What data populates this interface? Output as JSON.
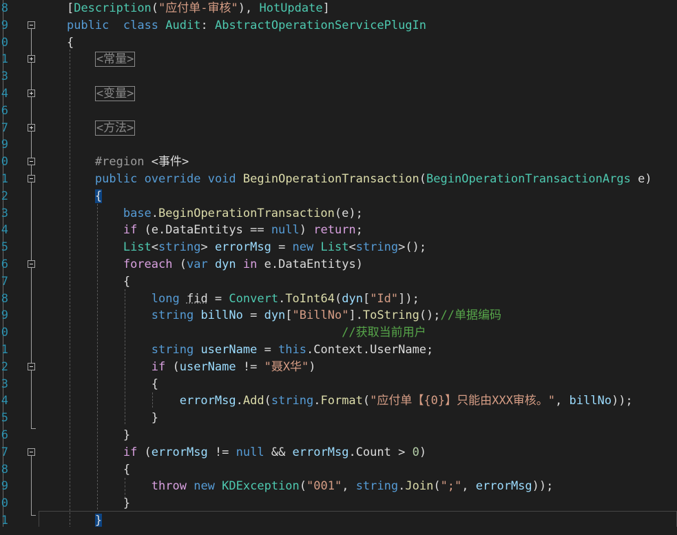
{
  "lines": [
    {
      "ln": "8",
      "indent": "    ",
      "tokens": [
        [
          "pl",
          "["
        ],
        [
          "type",
          "Description"
        ],
        [
          "pl",
          "("
        ],
        [
          "str",
          "\"应付单-审核\""
        ],
        [
          "pl",
          "), "
        ],
        [
          "type",
          "HotUpdate"
        ],
        [
          "pl",
          "]"
        ]
      ]
    },
    {
      "ln": "9",
      "indent": "    ",
      "fold": "minus",
      "tokens": [
        [
          "kw",
          "public"
        ],
        [
          "pl",
          "  "
        ],
        [
          "kw",
          "class"
        ],
        [
          "pl",
          " "
        ],
        [
          "type",
          "Audit"
        ],
        [
          "pl",
          ": "
        ],
        [
          "type",
          "AbstractOperationServicePlugIn"
        ]
      ]
    },
    {
      "ln": "0",
      "indent": "    ",
      "tokens": [
        [
          "pl",
          "{"
        ]
      ]
    },
    {
      "ln": "1",
      "indent": "        ",
      "fold": "plus",
      "tokens": [
        [
          "box",
          "<常量>"
        ]
      ]
    },
    {
      "ln": "3",
      "indent": "",
      "tokens": []
    },
    {
      "ln": "4",
      "indent": "        ",
      "fold": "plus",
      "tokens": [
        [
          "box",
          "<变量>"
        ]
      ]
    },
    {
      "ln": "6",
      "indent": "",
      "tokens": []
    },
    {
      "ln": "7",
      "indent": "        ",
      "fold": "plus",
      "tokens": [
        [
          "box",
          "<方法>"
        ]
      ]
    },
    {
      "ln": "9",
      "indent": "",
      "tokens": []
    },
    {
      "ln": "0",
      "indent": "        ",
      "fold": "minus",
      "tokens": [
        [
          "dir",
          "#region"
        ],
        [
          "pl",
          " "
        ],
        [
          "reg",
          "<事件>"
        ]
      ]
    },
    {
      "ln": "1",
      "indent": "        ",
      "fold": "minus",
      "tokens": [
        [
          "kw",
          "public"
        ],
        [
          "pl",
          " "
        ],
        [
          "kw",
          "override"
        ],
        [
          "pl",
          " "
        ],
        [
          "kw",
          "void"
        ],
        [
          "pl",
          " "
        ],
        [
          "meth",
          "BeginOperationTransaction"
        ],
        [
          "pl",
          "("
        ],
        [
          "type",
          "BeginOperationTransactionArgs"
        ],
        [
          "pl",
          " e)"
        ]
      ]
    },
    {
      "ln": "2",
      "indent": "        ",
      "tokens": [
        [
          "brace",
          "{"
        ]
      ]
    },
    {
      "ln": "3",
      "indent": "            ",
      "tokens": [
        [
          "kw",
          "base"
        ],
        [
          "pl",
          "."
        ],
        [
          "meth",
          "BeginOperationTransaction"
        ],
        [
          "pl",
          "(e);"
        ]
      ]
    },
    {
      "ln": "4",
      "indent": "            ",
      "tokens": [
        [
          "ctl",
          "if"
        ],
        [
          "pl",
          " (e."
        ],
        [
          "prop",
          "DataEntitys"
        ],
        [
          "pl",
          " == "
        ],
        [
          "kw",
          "null"
        ],
        [
          "pl",
          ") "
        ],
        [
          "ctl",
          "return"
        ],
        [
          "pl",
          ";"
        ]
      ]
    },
    {
      "ln": "5",
      "indent": "            ",
      "tokens": [
        [
          "type",
          "List"
        ],
        [
          "pl",
          "<"
        ],
        [
          "kw",
          "string"
        ],
        [
          "pl",
          "> "
        ],
        [
          "var",
          "errorMsg"
        ],
        [
          "pl",
          " = "
        ],
        [
          "kw",
          "new"
        ],
        [
          "pl",
          " "
        ],
        [
          "type",
          "List"
        ],
        [
          "pl",
          "<"
        ],
        [
          "kw",
          "string"
        ],
        [
          "pl",
          ">();"
        ]
      ]
    },
    {
      "ln": "6",
      "indent": "            ",
      "fold": "minus",
      "tokens": [
        [
          "ctl",
          "foreach"
        ],
        [
          "pl",
          " ("
        ],
        [
          "kw",
          "var"
        ],
        [
          "pl",
          " "
        ],
        [
          "var",
          "dyn"
        ],
        [
          "pl",
          " "
        ],
        [
          "ctl",
          "in"
        ],
        [
          "pl",
          " e."
        ],
        [
          "prop",
          "DataEntitys"
        ],
        [
          "pl",
          ")"
        ]
      ]
    },
    {
      "ln": "7",
      "indent": "            ",
      "tokens": [
        [
          "pl",
          "{"
        ]
      ]
    },
    {
      "ln": "8",
      "indent": "                ",
      "tokens": [
        [
          "kw",
          "long"
        ],
        [
          "pl",
          " "
        ],
        [
          "unused",
          "fid"
        ],
        [
          "pl",
          " = "
        ],
        [
          "type",
          "Convert"
        ],
        [
          "pl",
          "."
        ],
        [
          "meth",
          "ToInt64"
        ],
        [
          "pl",
          "("
        ],
        [
          "var",
          "dyn"
        ],
        [
          "pl",
          "["
        ],
        [
          "str",
          "\"Id\""
        ],
        [
          "pl",
          "]);"
        ]
      ]
    },
    {
      "ln": "9",
      "indent": "                ",
      "tokens": [
        [
          "kw",
          "string"
        ],
        [
          "pl",
          " "
        ],
        [
          "var",
          "billNo"
        ],
        [
          "pl",
          " = "
        ],
        [
          "var",
          "dyn"
        ],
        [
          "pl",
          "["
        ],
        [
          "str",
          "\"BillNo\""
        ],
        [
          "pl",
          "]."
        ],
        [
          "meth",
          "ToString"
        ],
        [
          "pl",
          "();"
        ],
        [
          "cmt",
          "//单据编码"
        ]
      ]
    },
    {
      "ln": "0",
      "indent": "                                           ",
      "tokens": [
        [
          "cmt",
          "//获取当前用户"
        ]
      ]
    },
    {
      "ln": "1",
      "indent": "                ",
      "tokens": [
        [
          "kw",
          "string"
        ],
        [
          "pl",
          " "
        ],
        [
          "var",
          "userName"
        ],
        [
          "pl",
          " = "
        ],
        [
          "kw",
          "this"
        ],
        [
          "pl",
          "."
        ],
        [
          "prop",
          "Context"
        ],
        [
          "pl",
          "."
        ],
        [
          "prop",
          "UserName"
        ],
        [
          "pl",
          ";"
        ]
      ]
    },
    {
      "ln": "2",
      "indent": "                ",
      "fold": "minus",
      "tokens": [
        [
          "ctl",
          "if"
        ],
        [
          "pl",
          " ("
        ],
        [
          "var",
          "userName"
        ],
        [
          "pl",
          " != "
        ],
        [
          "str",
          "\"聂X华\""
        ],
        [
          "pl",
          ")"
        ]
      ]
    },
    {
      "ln": "3",
      "indent": "                ",
      "tokens": [
        [
          "pl",
          "{"
        ]
      ]
    },
    {
      "ln": "4",
      "indent": "                    ",
      "tokens": [
        [
          "var",
          "errorMsg"
        ],
        [
          "pl",
          "."
        ],
        [
          "meth",
          "Add"
        ],
        [
          "pl",
          "("
        ],
        [
          "kw",
          "string"
        ],
        [
          "pl",
          "."
        ],
        [
          "meth",
          "Format"
        ],
        [
          "pl",
          "("
        ],
        [
          "str",
          "\"应付单【{0}】只能由XXX审核。\""
        ],
        [
          "pl",
          ", "
        ],
        [
          "var",
          "billNo"
        ],
        [
          "pl",
          "));"
        ]
      ]
    },
    {
      "ln": "5",
      "indent": "                ",
      "tokens": [
        [
          "pl",
          "}"
        ]
      ]
    },
    {
      "ln": "6",
      "indent": "            ",
      "foldEnd": true,
      "tokens": [
        [
          "pl",
          "}"
        ]
      ]
    },
    {
      "ln": "7",
      "indent": "            ",
      "fold": "minus",
      "tokens": [
        [
          "ctl",
          "if"
        ],
        [
          "pl",
          " ("
        ],
        [
          "var",
          "errorMsg"
        ],
        [
          "pl",
          " != "
        ],
        [
          "kw",
          "null"
        ],
        [
          "pl",
          " && "
        ],
        [
          "var",
          "errorMsg"
        ],
        [
          "pl",
          "."
        ],
        [
          "prop",
          "Count"
        ],
        [
          "pl",
          " > "
        ],
        [
          "num",
          "0"
        ],
        [
          "pl",
          ")"
        ]
      ]
    },
    {
      "ln": "8",
      "indent": "            ",
      "tokens": [
        [
          "pl",
          "{"
        ]
      ]
    },
    {
      "ln": "9",
      "indent": "                ",
      "tokens": [
        [
          "ctl",
          "throw"
        ],
        [
          "pl",
          " "
        ],
        [
          "kw",
          "new"
        ],
        [
          "pl",
          " "
        ],
        [
          "type",
          "KDException"
        ],
        [
          "pl",
          "("
        ],
        [
          "str",
          "\"001\""
        ],
        [
          "pl",
          ", "
        ],
        [
          "kw",
          "string"
        ],
        [
          "pl",
          "."
        ],
        [
          "meth",
          "Join"
        ],
        [
          "pl",
          "("
        ],
        [
          "str",
          "\";\""
        ],
        [
          "pl",
          ", "
        ],
        [
          "var",
          "errorMsg"
        ],
        [
          "pl",
          "));"
        ]
      ]
    },
    {
      "ln": "0",
      "indent": "            ",
      "tokens": [
        [
          "pl",
          "}"
        ]
      ]
    },
    {
      "ln": "1",
      "indent": "        ",
      "foldEnd": true,
      "current": true,
      "tokens": [
        [
          "brace",
          "}"
        ]
      ]
    }
  ]
}
